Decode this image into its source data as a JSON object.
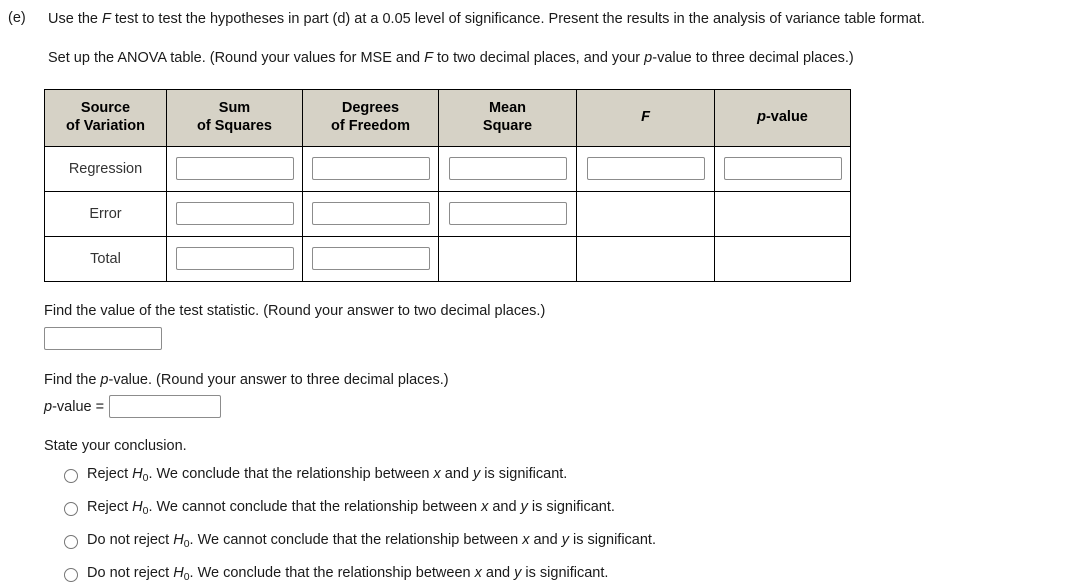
{
  "part": {
    "label": "(e)",
    "statement_1_pre": "Use the ",
    "statement_1_f": "F",
    "statement_1_post": " test to test the hypotheses in part (d) at a 0.05 level of significance. Present the results in the analysis of variance table format.",
    "statement_2_pre": "Set up the ANOVA table. (Round your values for MSE and ",
    "statement_2_f": "F",
    "statement_2_mid": " to two decimal places, and your ",
    "statement_2_p": "p",
    "statement_2_post": "-value to three decimal places.)"
  },
  "anova_table": {
    "headers": [
      {
        "line1": "Source",
        "line2": "of Variation",
        "italic": false
      },
      {
        "line1": "Sum",
        "line2": "of Squares",
        "italic": false
      },
      {
        "line1": "Degrees",
        "line2": "of Freedom",
        "italic": false
      },
      {
        "line1": "Mean",
        "line2": "Square",
        "italic": false
      },
      {
        "line1": "F",
        "line2": "",
        "italic": true
      },
      {
        "line1": "p-value",
        "line2": "",
        "italic": false
      }
    ],
    "header_f_label": "F",
    "header_p_italic": "p",
    "header_p_rest": "-value",
    "rows": [
      {
        "source": "Regression",
        "inputs": [
          true,
          true,
          true,
          true,
          true
        ],
        "values": [
          "",
          "",
          "",
          "",
          ""
        ]
      },
      {
        "source": "Error",
        "inputs": [
          true,
          true,
          true,
          false,
          false
        ],
        "values": [
          "",
          "",
          "",
          "",
          ""
        ]
      },
      {
        "source": "Total",
        "inputs": [
          true,
          true,
          false,
          false,
          false
        ],
        "values": [
          "",
          "",
          "",
          "",
          ""
        ]
      }
    ],
    "header_bg": "#d6d2c6",
    "border_color": "#000000"
  },
  "find_statistic": {
    "question": "Find the value of the test statistic. (Round your answer to two decimal places.)",
    "value": "",
    "placeholder": ""
  },
  "find_pvalue": {
    "question_pre": "Find the ",
    "question_p": "p",
    "question_post": "-value. (Round your answer to three decimal places.)",
    "label_p": "p",
    "label_rest": "-value =",
    "value": "",
    "placeholder": ""
  },
  "conclusion": {
    "prompt": "State your conclusion.",
    "options": [
      {
        "t1": "Reject ",
        "h": "H",
        "sub": "0",
        "t2": ". We conclude that the relationship between ",
        "x": "x",
        "t3": " and ",
        "y": "y",
        "t4": " is significant.",
        "selected": false
      },
      {
        "t1": "Reject ",
        "h": "H",
        "sub": "0",
        "t2": ". We cannot conclude that the relationship between ",
        "x": "x",
        "t3": " and ",
        "y": "y",
        "t4": " is significant.",
        "selected": false
      },
      {
        "t1": "Do not reject ",
        "h": "H",
        "sub": "0",
        "t2": ". We cannot conclude that the relationship between ",
        "x": "x",
        "t3": " and ",
        "y": "y",
        "t4": " is significant.",
        "selected": false
      },
      {
        "t1": "Do not reject ",
        "h": "H",
        "sub": "0",
        "t2": ". We conclude that the relationship between ",
        "x": "x",
        "t3": " and ",
        "y": "y",
        "t4": " is significant.",
        "selected": false
      }
    ]
  }
}
